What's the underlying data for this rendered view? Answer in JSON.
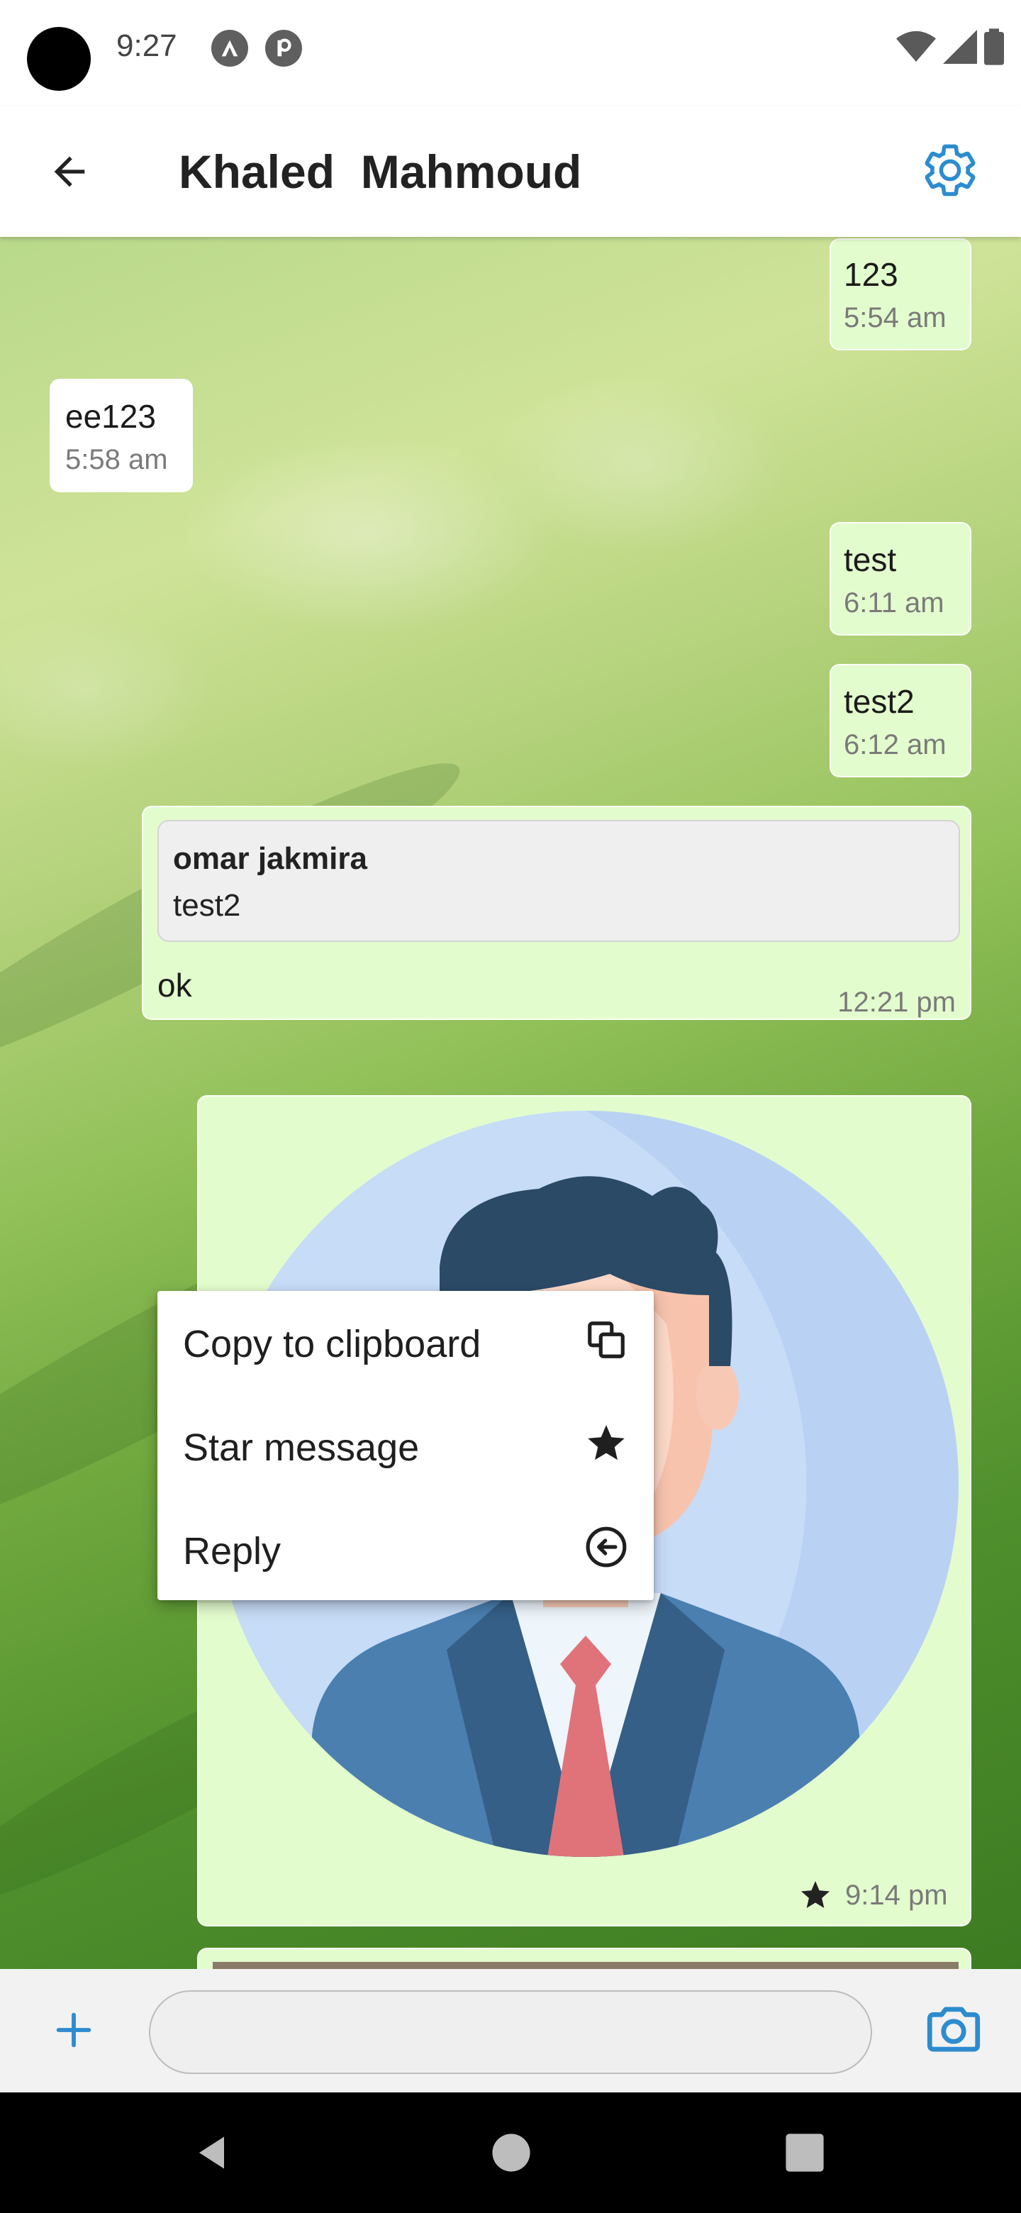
{
  "status_bar": {
    "time": "9:27",
    "icons": [
      "notification-a-icon",
      "notification-p-icon",
      "wifi-icon",
      "signal-icon",
      "battery-icon"
    ]
  },
  "app_bar": {
    "title": "Khaled  Mahmoud",
    "back_icon": "arrow-back-icon",
    "settings_icon": "gear-icon",
    "accent_color": "#2d8ccf"
  },
  "messages": [
    {
      "direction": "outgoing",
      "text": "123",
      "time": "5:54 am"
    },
    {
      "direction": "incoming",
      "text": "ee123",
      "time": "5:58 am"
    },
    {
      "direction": "outgoing",
      "text": "test",
      "time": "6:11 am"
    },
    {
      "direction": "outgoing",
      "text": "test2",
      "time": "6:12 am"
    },
    {
      "direction": "outgoing",
      "quoted_name": "omar jakmira",
      "quoted_text": "test2",
      "text": "ok",
      "time": "12:21 pm"
    },
    {
      "direction": "outgoing",
      "type": "image",
      "image_icon": "person-avatar-icon",
      "starred": true,
      "time": "9:14 pm"
    }
  ],
  "context_menu": {
    "items": [
      {
        "label": "Copy to clipboard",
        "icon": "copy-icon"
      },
      {
        "label": "Star message",
        "icon": "star-icon"
      },
      {
        "label": "Reply",
        "icon": "reply-icon"
      }
    ]
  },
  "input_bar": {
    "add_icon": "plus-icon",
    "placeholder": "",
    "value": "",
    "camera_icon": "camera-icon"
  },
  "colors": {
    "outgoing_bubble": "#e3fccd",
    "incoming_bubble": "#ffffff",
    "accent": "#2d8ccf"
  }
}
